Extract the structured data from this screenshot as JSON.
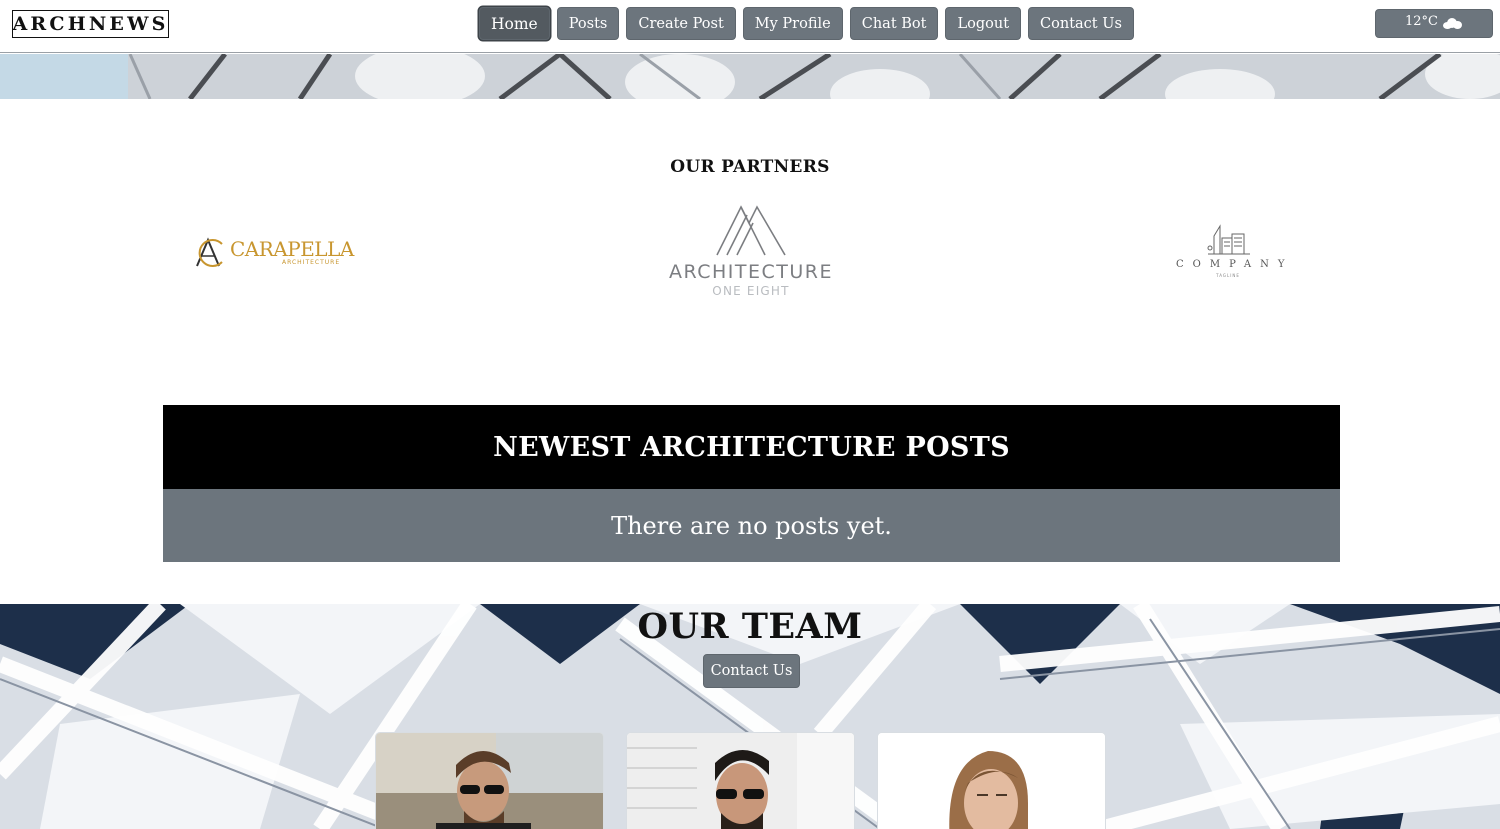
{
  "brand": {
    "name": "ARCHNEWS"
  },
  "nav": {
    "items": [
      {
        "label": "Home",
        "active": true
      },
      {
        "label": "Posts"
      },
      {
        "label": "Create Post"
      },
      {
        "label": "My Profile"
      },
      {
        "label": "Chat Bot"
      },
      {
        "label": "Logout"
      },
      {
        "label": "Contact Us"
      }
    ]
  },
  "weather": {
    "temperature": "12°C",
    "icon": "cloud-icon"
  },
  "partners": {
    "title": "OUR PARTNERS",
    "logos": [
      {
        "name": "CARAPELLA",
        "subtitle": "ARCHITECTURE",
        "color": "#c8962f"
      },
      {
        "name": "ARCHITECTURE",
        "subtitle": "ONE EIGHT",
        "color": "#7c7e82"
      },
      {
        "name": "COMPANY",
        "subtitle": "TAGLINE",
        "color": "#555555"
      }
    ]
  },
  "posts": {
    "title": "NEWEST ARCHITECTURE POSTS",
    "empty_message": "There are no posts yet."
  },
  "team": {
    "title": "OUR TEAM",
    "contact_label": "Contact Us",
    "members": [
      {
        "photo": "team-member-photo"
      },
      {
        "photo": "team-member-photo"
      },
      {
        "photo": "team-member-photo"
      }
    ]
  },
  "colors": {
    "button": "#6c757d",
    "header_bg": "#000000",
    "accent_gold": "#c8962f"
  }
}
